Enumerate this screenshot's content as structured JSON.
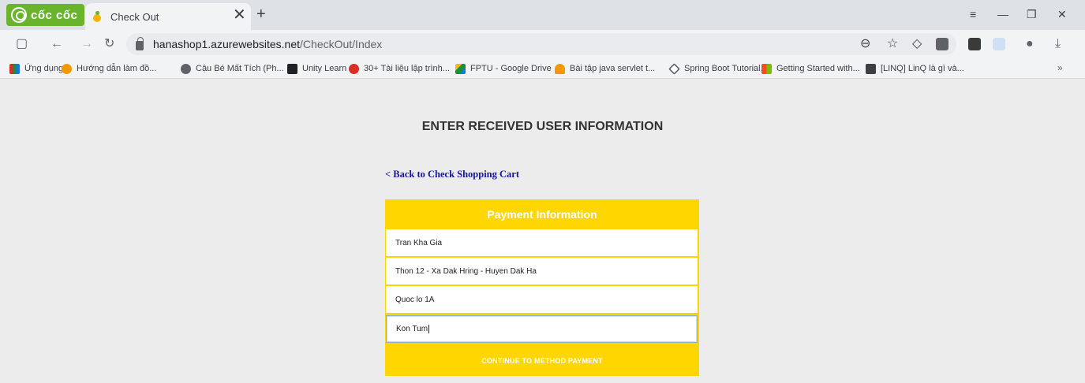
{
  "browser": {
    "logo_text": "cốc cốc",
    "tab_title": "Check Out",
    "tab_close": "✕",
    "new_tab": "+",
    "url_host": "hanashop1.azurewebsites.net",
    "url_path": "/CheckOut/Index"
  },
  "bookmarks": {
    "items": [
      {
        "label": "Ứng dụng",
        "color": "#d93025"
      },
      {
        "label": "Hướng dẫn làm đồ...",
        "color": "#f29900"
      },
      {
        "label": "Cậu Bé Mất Tích (Ph...",
        "color": "#5f6368"
      },
      {
        "label": "Unity Learn",
        "color": "#202124"
      },
      {
        "label": "30+ Tài liệu lập trình...",
        "color": "#d93025"
      },
      {
        "label": "FPTU - Google Drive",
        "color": "#1e8e3e"
      },
      {
        "label": "Bài tập java servlet t...",
        "color": "#f29900"
      },
      {
        "label": "Spring Boot Tutorial...",
        "color": "#5f6368"
      },
      {
        "label": "Getting Started with...",
        "color": "#f25022"
      },
      {
        "label": "[LINQ] LinQ là gì và...",
        "color": "#3c4043"
      }
    ],
    "more": "»"
  },
  "page": {
    "title": "ENTER RECEIVED USER INFORMATION",
    "back_link": "< Back to Check Shopping Cart",
    "card": {
      "header": "Payment Information",
      "fields": [
        "Tran Kha Gia",
        "Thon 12 - Xa Dak Hring - Huyen Dak Ha",
        "Quoc lo 1A",
        "Kon Tum"
      ],
      "continue_label": "CONTINUE TO METHOD PAYMENT"
    }
  },
  "colors": {
    "card_yellow": "#ffd600",
    "link_blue": "#1515a0",
    "page_bg": "#ececec"
  }
}
